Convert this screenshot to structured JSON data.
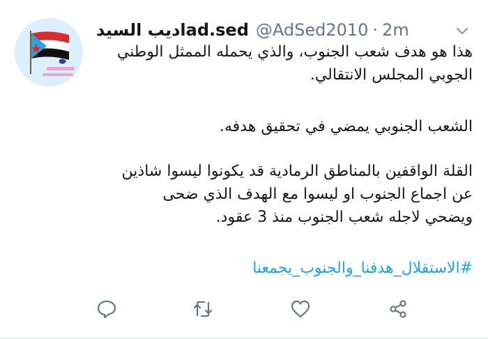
{
  "tweet": {
    "display_name": "اديب السيدad.sed",
    "handle": "@AdSed2010",
    "separator": "·",
    "time": "2m",
    "paragraph1": "هذا هو هدف شعب الجنوب، والذي يحمله الممثل الوطني الجوبي المجلس الانتقالي.",
    "paragraph2": "الشعب الجنوبي يمضي في تحقيق هدفه.",
    "paragraph3_lines": [
      "القلة الواقفين بالمناطق الرمادية قد يكونوا ليسوا شاذين",
      "عن اجماع الجنوب او ليسوا مع الهدف الذي  ضحى",
      "ويضحي لاجله شعب الجنوب منذ 3 عقود."
    ],
    "hashtag": "#الاستقلال_هدفنا_والجنوب_يجمعنا"
  },
  "icons": {
    "avatar": "avatar-flag-image",
    "menu": "chevron-down-icon",
    "reply": "reply-icon",
    "retweet": "retweet-icon",
    "like": "heart-icon",
    "share": "share-icon"
  },
  "colors": {
    "text": "#14171a",
    "muted": "#657786",
    "link": "#1da1f2",
    "icon": "#657786"
  }
}
